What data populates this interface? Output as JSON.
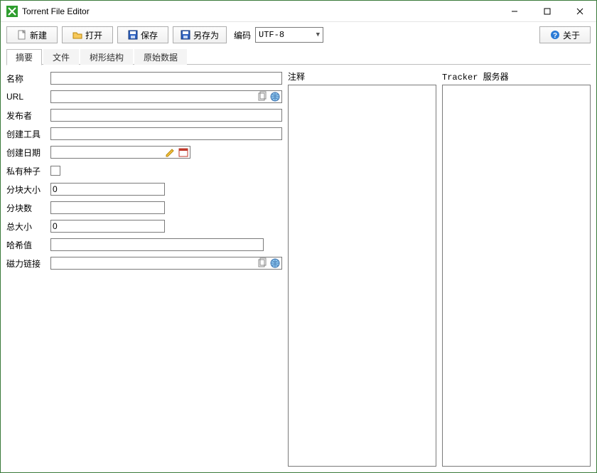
{
  "title": "Torrent File Editor",
  "toolbar": {
    "new_label": "新建",
    "open_label": "打开",
    "save_label": "保存",
    "saveas_label": "另存为",
    "encoding_label": "编码",
    "encoding_value": "UTF-8",
    "about_label": "关于"
  },
  "tabs": [
    {
      "label": "摘要",
      "active": true
    },
    {
      "label": "文件",
      "active": false
    },
    {
      "label": "树形结构",
      "active": false
    },
    {
      "label": "原始数据",
      "active": false
    }
  ],
  "form": {
    "name_label": "名称",
    "name_value": "",
    "url_label": "URL",
    "url_value": "",
    "publisher_label": "发布者",
    "publisher_value": "",
    "created_by_label": "创建工具",
    "created_by_value": "",
    "creation_date_label": "创建日期",
    "creation_date_value": "",
    "private_label": "私有种子",
    "private_checked": false,
    "piece_size_label": "分块大小",
    "piece_size_value": "0",
    "piece_count_label": "分块数",
    "piece_count_value": "",
    "total_size_label": "总大小",
    "total_size_value": "0",
    "hash_label": "哈希值",
    "hash_value": "",
    "magnet_label": "磁力链接",
    "magnet_value": ""
  },
  "annotation_label": "注释",
  "tracker_label": "Tracker 服务器"
}
